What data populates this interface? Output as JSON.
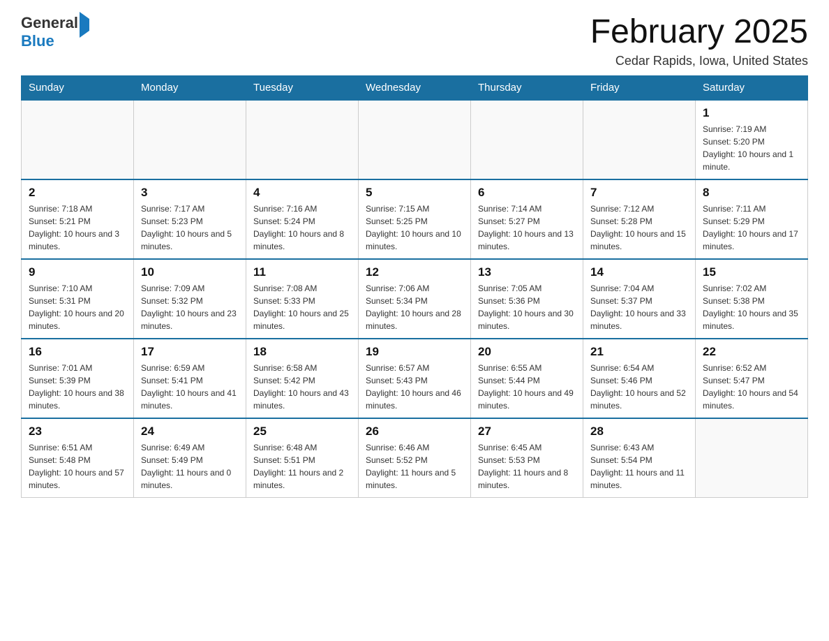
{
  "header": {
    "logo_general": "General",
    "logo_blue": "Blue",
    "month_title": "February 2025",
    "location": "Cedar Rapids, Iowa, United States"
  },
  "days_of_week": [
    "Sunday",
    "Monday",
    "Tuesday",
    "Wednesday",
    "Thursday",
    "Friday",
    "Saturday"
  ],
  "weeks": [
    [
      {
        "day": "",
        "info": ""
      },
      {
        "day": "",
        "info": ""
      },
      {
        "day": "",
        "info": ""
      },
      {
        "day": "",
        "info": ""
      },
      {
        "day": "",
        "info": ""
      },
      {
        "day": "",
        "info": ""
      },
      {
        "day": "1",
        "info": "Sunrise: 7:19 AM\nSunset: 5:20 PM\nDaylight: 10 hours and 1 minute."
      }
    ],
    [
      {
        "day": "2",
        "info": "Sunrise: 7:18 AM\nSunset: 5:21 PM\nDaylight: 10 hours and 3 minutes."
      },
      {
        "day": "3",
        "info": "Sunrise: 7:17 AM\nSunset: 5:23 PM\nDaylight: 10 hours and 5 minutes."
      },
      {
        "day": "4",
        "info": "Sunrise: 7:16 AM\nSunset: 5:24 PM\nDaylight: 10 hours and 8 minutes."
      },
      {
        "day": "5",
        "info": "Sunrise: 7:15 AM\nSunset: 5:25 PM\nDaylight: 10 hours and 10 minutes."
      },
      {
        "day": "6",
        "info": "Sunrise: 7:14 AM\nSunset: 5:27 PM\nDaylight: 10 hours and 13 minutes."
      },
      {
        "day": "7",
        "info": "Sunrise: 7:12 AM\nSunset: 5:28 PM\nDaylight: 10 hours and 15 minutes."
      },
      {
        "day": "8",
        "info": "Sunrise: 7:11 AM\nSunset: 5:29 PM\nDaylight: 10 hours and 17 minutes."
      }
    ],
    [
      {
        "day": "9",
        "info": "Sunrise: 7:10 AM\nSunset: 5:31 PM\nDaylight: 10 hours and 20 minutes."
      },
      {
        "day": "10",
        "info": "Sunrise: 7:09 AM\nSunset: 5:32 PM\nDaylight: 10 hours and 23 minutes."
      },
      {
        "day": "11",
        "info": "Sunrise: 7:08 AM\nSunset: 5:33 PM\nDaylight: 10 hours and 25 minutes."
      },
      {
        "day": "12",
        "info": "Sunrise: 7:06 AM\nSunset: 5:34 PM\nDaylight: 10 hours and 28 minutes."
      },
      {
        "day": "13",
        "info": "Sunrise: 7:05 AM\nSunset: 5:36 PM\nDaylight: 10 hours and 30 minutes."
      },
      {
        "day": "14",
        "info": "Sunrise: 7:04 AM\nSunset: 5:37 PM\nDaylight: 10 hours and 33 minutes."
      },
      {
        "day": "15",
        "info": "Sunrise: 7:02 AM\nSunset: 5:38 PM\nDaylight: 10 hours and 35 minutes."
      }
    ],
    [
      {
        "day": "16",
        "info": "Sunrise: 7:01 AM\nSunset: 5:39 PM\nDaylight: 10 hours and 38 minutes."
      },
      {
        "day": "17",
        "info": "Sunrise: 6:59 AM\nSunset: 5:41 PM\nDaylight: 10 hours and 41 minutes."
      },
      {
        "day": "18",
        "info": "Sunrise: 6:58 AM\nSunset: 5:42 PM\nDaylight: 10 hours and 43 minutes."
      },
      {
        "day": "19",
        "info": "Sunrise: 6:57 AM\nSunset: 5:43 PM\nDaylight: 10 hours and 46 minutes."
      },
      {
        "day": "20",
        "info": "Sunrise: 6:55 AM\nSunset: 5:44 PM\nDaylight: 10 hours and 49 minutes."
      },
      {
        "day": "21",
        "info": "Sunrise: 6:54 AM\nSunset: 5:46 PM\nDaylight: 10 hours and 52 minutes."
      },
      {
        "day": "22",
        "info": "Sunrise: 6:52 AM\nSunset: 5:47 PM\nDaylight: 10 hours and 54 minutes."
      }
    ],
    [
      {
        "day": "23",
        "info": "Sunrise: 6:51 AM\nSunset: 5:48 PM\nDaylight: 10 hours and 57 minutes."
      },
      {
        "day": "24",
        "info": "Sunrise: 6:49 AM\nSunset: 5:49 PM\nDaylight: 11 hours and 0 minutes."
      },
      {
        "day": "25",
        "info": "Sunrise: 6:48 AM\nSunset: 5:51 PM\nDaylight: 11 hours and 2 minutes."
      },
      {
        "day": "26",
        "info": "Sunrise: 6:46 AM\nSunset: 5:52 PM\nDaylight: 11 hours and 5 minutes."
      },
      {
        "day": "27",
        "info": "Sunrise: 6:45 AM\nSunset: 5:53 PM\nDaylight: 11 hours and 8 minutes."
      },
      {
        "day": "28",
        "info": "Sunrise: 6:43 AM\nSunset: 5:54 PM\nDaylight: 11 hours and 11 minutes."
      },
      {
        "day": "",
        "info": ""
      }
    ]
  ]
}
